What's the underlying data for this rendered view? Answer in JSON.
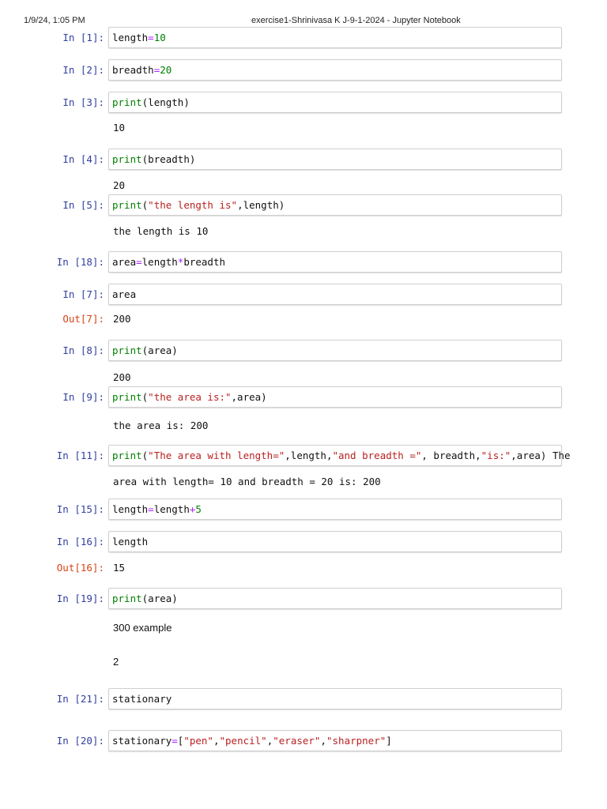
{
  "header": {
    "datetime": "1/9/24, 1:05 PM",
    "title": "exercise1-Shrinivasa K J-9-1-2024 - Jupyter Notebook"
  },
  "colors": {
    "in_prompt": "#303f9f",
    "out_prompt": "#d84315",
    "keyword": "#008000",
    "string": "#ba2121",
    "operator": "#aa22ff"
  },
  "cells": [
    {
      "prompt": "In [1]:",
      "code": [
        [
          "length",
          "pl"
        ],
        [
          "=",
          "op"
        ],
        [
          "10",
          "num"
        ]
      ],
      "outputs": []
    },
    {
      "prompt": "In [2]:",
      "code": [
        [
          "breadth",
          "pl"
        ],
        [
          "=",
          "op"
        ],
        [
          "20",
          "num"
        ]
      ],
      "outputs": []
    },
    {
      "prompt": "In [3]:",
      "code": [
        [
          "print",
          "kw"
        ],
        [
          "(length)",
          "pl"
        ]
      ],
      "outputs": [
        {
          "text": "10"
        }
      ]
    },
    {
      "prompt": "In [4]:",
      "code": [
        [
          "print",
          "kw"
        ],
        [
          "(breadth)",
          "pl"
        ]
      ],
      "outputs": [
        {
          "text": "20"
        }
      ]
    },
    {
      "prompt": "In [5]:",
      "code": [
        [
          "print",
          "kw"
        ],
        [
          "(",
          "pl"
        ],
        [
          "\"the length is\"",
          "str"
        ],
        [
          ",length)",
          "pl"
        ]
      ],
      "outputs": [
        {
          "text": "the length is 10"
        }
      ]
    },
    {
      "prompt": "In [18]:",
      "code": [
        [
          "area",
          "pl"
        ],
        [
          "=",
          "op"
        ],
        [
          "length",
          "pl"
        ],
        [
          "*",
          "op"
        ],
        [
          "breadth",
          "pl"
        ]
      ],
      "outputs": []
    },
    {
      "prompt": "In [7]:",
      "code": [
        [
          "area",
          "pl"
        ]
      ],
      "outputs": [
        {
          "prompt": "Out[7]:",
          "text": "200"
        }
      ]
    },
    {
      "prompt": "In [8]:",
      "code": [
        [
          "print",
          "kw"
        ],
        [
          "(area)",
          "pl"
        ]
      ],
      "outputs": [
        {
          "text": "200"
        }
      ]
    },
    {
      "prompt": "In [9]:",
      "code": [
        [
          "print",
          "kw"
        ],
        [
          "(",
          "pl"
        ],
        [
          "\"the area is:\"",
          "str"
        ],
        [
          ",area)",
          "pl"
        ]
      ],
      "outputs": [
        {
          "text": "the area is: 200"
        }
      ]
    },
    {
      "prompt": "In [11]:",
      "code": [
        [
          "print",
          "kw"
        ],
        [
          "(",
          "pl"
        ],
        [
          "\"The area with length=\"",
          "str"
        ],
        [
          ",length,",
          "pl"
        ],
        [
          "\"and breadth =\"",
          "str"
        ],
        [
          ", breadth,",
          "pl"
        ],
        [
          "\"is:\"",
          "str"
        ],
        [
          ",area) The",
          "pl"
        ]
      ],
      "outputs": [
        {
          "text": "area with length= 10 and breadth = 20 is: 200"
        }
      ]
    },
    {
      "prompt": "In [15]:",
      "code": [
        [
          "length",
          "pl"
        ],
        [
          "=",
          "op"
        ],
        [
          "length",
          "pl"
        ],
        [
          "+",
          "op"
        ],
        [
          "5",
          "num"
        ]
      ],
      "outputs": []
    },
    {
      "prompt": "In [16]:",
      "code": [
        [
          "length",
          "pl"
        ]
      ],
      "outputs": [
        {
          "prompt": "Out[16]:",
          "text": "15"
        }
      ]
    },
    {
      "prompt": "In [19]:",
      "code": [
        [
          "print",
          "kw"
        ],
        [
          "(area)",
          "pl"
        ]
      ],
      "outputs": [
        {
          "text": "300 example",
          "sans": true
        },
        {
          "text": "2",
          "sans": true
        }
      ]
    },
    {
      "prompt": "In [21]:",
      "code": [
        [
          "stationary",
          "pl"
        ]
      ],
      "outputs": []
    },
    {
      "prompt": "In [20]:",
      "code": [
        [
          "stationary",
          "pl"
        ],
        [
          "=",
          "op"
        ],
        [
          "[",
          "pl"
        ],
        [
          "\"pen\"",
          "str"
        ],
        [
          ",",
          "pl"
        ],
        [
          "\"pencil\"",
          "str"
        ],
        [
          ",",
          "pl"
        ],
        [
          "\"eraser\"",
          "str"
        ],
        [
          ",",
          "pl"
        ],
        [
          "\"sharpner\"",
          "str"
        ],
        [
          "]",
          "pl"
        ]
      ],
      "outputs": []
    }
  ]
}
